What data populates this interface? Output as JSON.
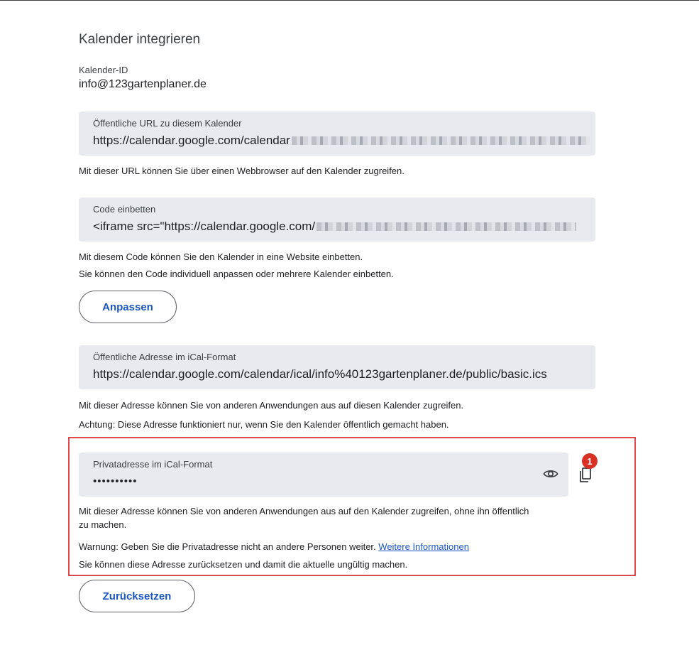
{
  "section": {
    "title": "Kalender integrieren",
    "id_label": "Kalender-ID",
    "id_value": "info@123gartenplaner.de"
  },
  "public_url": {
    "label": "Öffentliche URL zu diesem Kalender",
    "value_visible": "https://calendar.google.com/calendar",
    "helper": "Mit dieser URL können Sie über einen Webbrowser auf den Kalender zugreifen."
  },
  "embed_code": {
    "label": "Code einbetten",
    "value_visible": "<iframe src=\"https://calendar.google.com/",
    "helper_1": "Mit diesem Code können Sie den Kalender in eine Website einbetten.",
    "helper_2": "Sie können den Code individuell anpassen oder mehrere Kalender einbetten.",
    "customize_button": "Anpassen"
  },
  "public_ical": {
    "label": "Öffentliche Adresse im iCal-Format",
    "value": "https://calendar.google.com/calendar/ical/info%40123gartenplaner.de/public/basic.ics",
    "helper_1": "Mit dieser Adresse können Sie von anderen Anwendungen aus auf diesen Kalender zugreifen.",
    "helper_2": "Achtung: Diese Adresse funktioniert nur, wenn Sie den Kalender öffentlich gemacht haben."
  },
  "private_ical": {
    "label": "Privatadresse im iCal-Format",
    "value_masked": "••••••••••",
    "badge": "1",
    "helper_1_line1": "Mit dieser Adresse können Sie von anderen Anwendungen aus auf den Kalender zugreifen, ohne ihn öffentlich",
    "helper_1_line2": "zu machen.",
    "warning": "Warnung: Geben Sie die Privatadresse nicht an andere Personen weiter.",
    "more_info_link": "Weitere Informationen",
    "reset_note": "Sie können diese Adresse zurücksetzen und damit die aktuelle ungültig machen.",
    "reset_button": "Zurücksetzen"
  },
  "colors": {
    "field_bg": "#e8eaf0",
    "accent": "#1a56c5",
    "highlight": "#e0474c",
    "badge": "#d93025"
  }
}
